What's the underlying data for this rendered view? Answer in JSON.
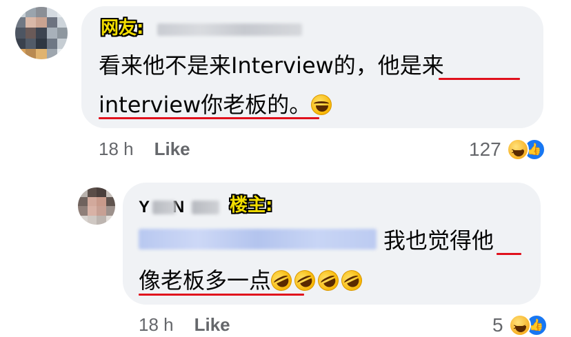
{
  "comment1": {
    "tag": "网友:",
    "text_line1": "看来他不是来Interview的，他是来",
    "text_line2": "interview你老板的。",
    "time": "18 h",
    "like_label": "Like",
    "reaction_count": "127"
  },
  "reply1": {
    "author_initials": "Y",
    "author_middle": "N",
    "tag": "楼主:",
    "text_line1": "我也觉得他",
    "text_line2": "像老板多一点",
    "time": "18 h",
    "like_label": "Like",
    "reaction_count": "5"
  },
  "colors": {
    "bubble": "#f0f2f5",
    "underline": "#e0101c",
    "tag_fill": "#f3de00",
    "like_blue": "#1877f2",
    "meta_gray": "#65676b"
  },
  "icons": [
    "avatar",
    "tears-of-joy-emoji",
    "rolling-laughing-emoji",
    "haha-reaction-icon",
    "like-reaction-icon"
  ]
}
